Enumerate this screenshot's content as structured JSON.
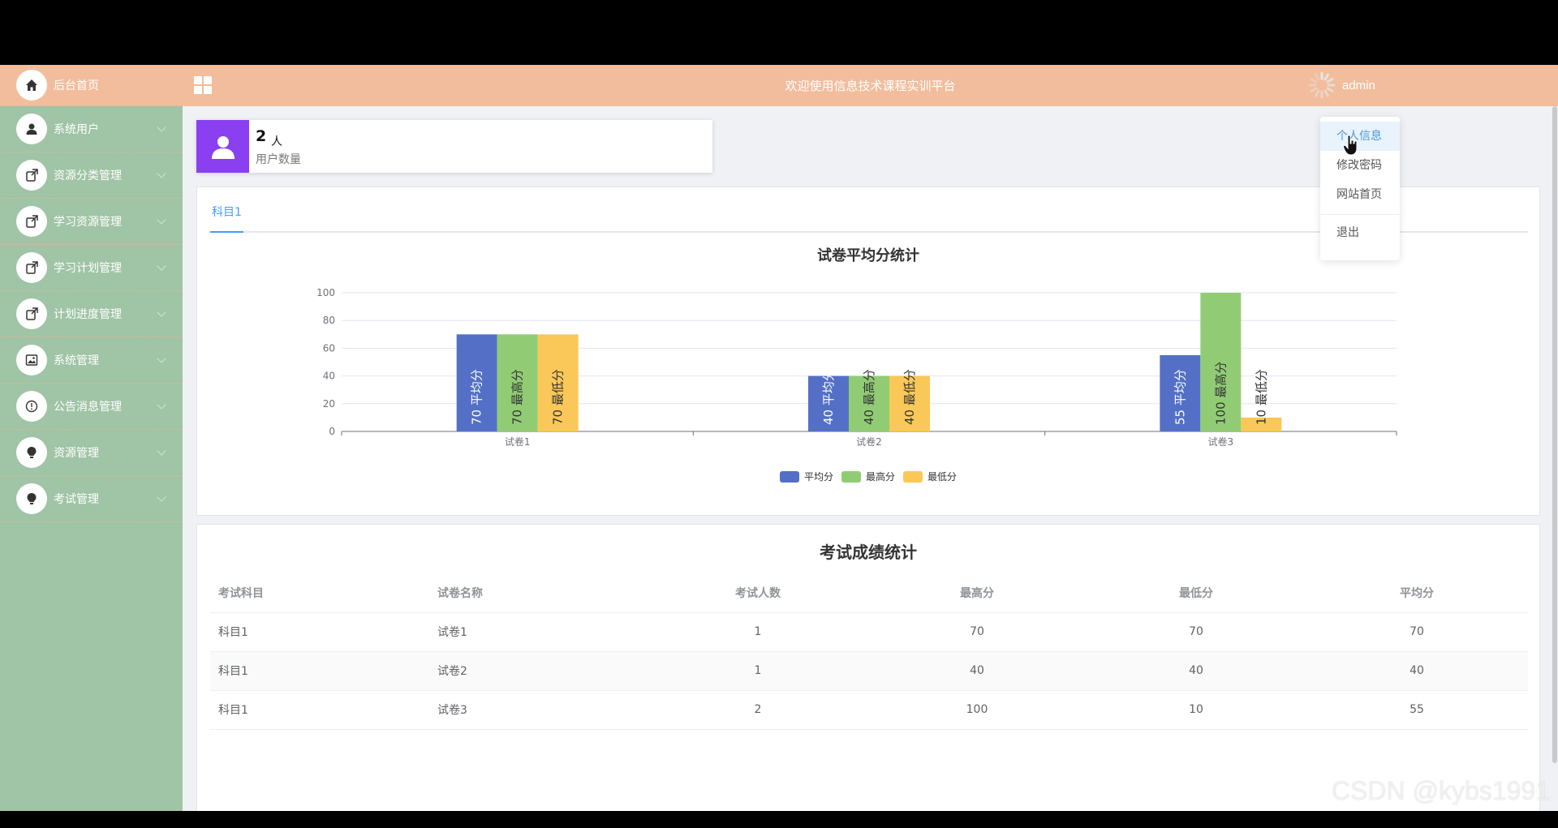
{
  "colors": {
    "header_bg": "#f2bd9c",
    "sidebar_bg": "#a0c4a6",
    "accent": "#409eff",
    "avg": "#5470c6",
    "max": "#91cc75",
    "min": "#fac858",
    "user_card_icon": "#8a3ff0"
  },
  "sidebar": {
    "items": [
      {
        "label": "后台首页",
        "icon": "home-icon",
        "active": true
      },
      {
        "label": "系统用户",
        "icon": "user-icon"
      },
      {
        "label": "资源分类管理",
        "icon": "edit-doc-icon"
      },
      {
        "label": "学习资源管理",
        "icon": "edit-doc-icon"
      },
      {
        "label": "学习计划管理",
        "icon": "edit-doc-icon"
      },
      {
        "label": "计划进度管理",
        "icon": "edit-doc-icon"
      },
      {
        "label": "系统管理",
        "icon": "image-icon"
      },
      {
        "label": "公告消息管理",
        "icon": "info-icon"
      },
      {
        "label": "资源管理",
        "icon": "bulb-icon"
      },
      {
        "label": "考试管理",
        "icon": "bulb-icon"
      }
    ]
  },
  "header": {
    "title": "欢迎使用信息技术课程实训平台",
    "user_name": "admin"
  },
  "user_menu": {
    "items": [
      "个人信息",
      "修改密码",
      "网站首页",
      "退出"
    ]
  },
  "user_card": {
    "count": "2",
    "unit": "人",
    "label": "用户数量"
  },
  "tabs": [
    "科目1"
  ],
  "chart_data": {
    "type": "bar",
    "title": "试卷平均分统计",
    "categories": [
      "试卷1",
      "试卷2",
      "试卷3"
    ],
    "series": [
      {
        "name": "平均分",
        "values": [
          70,
          40,
          55
        ]
      },
      {
        "name": "最高分",
        "values": [
          70,
          40,
          100
        ]
      },
      {
        "name": "最低分",
        "values": [
          70,
          40,
          10
        ]
      }
    ],
    "ylim": [
      0,
      100
    ],
    "yticks": [
      0,
      20,
      40,
      60,
      80,
      100
    ],
    "legend": "bottom-center",
    "grid": true
  },
  "score_table": {
    "title": "考试成绩统计",
    "columns": [
      "考试科目",
      "试卷名称",
      "考试人数",
      "最高分",
      "最低分",
      "平均分"
    ],
    "rows": [
      [
        "科目1",
        "试卷1",
        "1",
        "70",
        "70",
        "70"
      ],
      [
        "科目1",
        "试卷2",
        "1",
        "40",
        "40",
        "40"
      ],
      [
        "科目1",
        "试卷3",
        "2",
        "100",
        "10",
        "55"
      ]
    ]
  },
  "watermark": "CSDN @kybs1991"
}
